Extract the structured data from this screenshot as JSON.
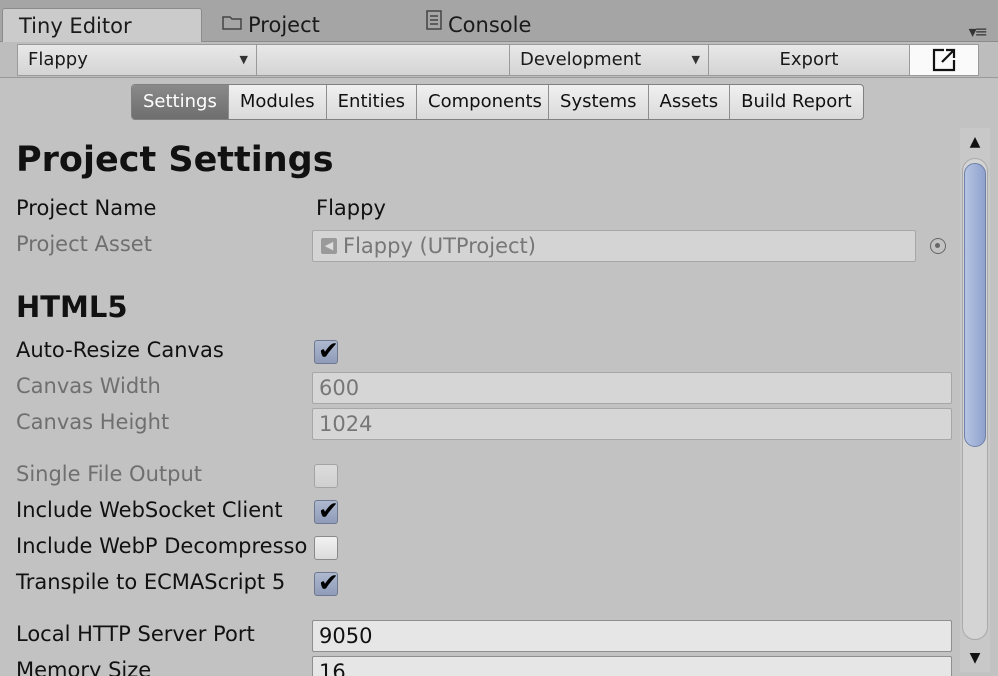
{
  "window_tabs": [
    {
      "label": "Tiny Editor",
      "icon": "",
      "active": true
    },
    {
      "label": "Project",
      "icon": "folder-icon",
      "active": false
    },
    {
      "label": "Console",
      "icon": "document-icon",
      "active": false
    }
  ],
  "toolbar": {
    "project_select": "Flappy",
    "config_select": "Development",
    "export_label": "Export",
    "popout_icon": "external-link-icon"
  },
  "subtabs": [
    {
      "label": "Settings",
      "active": true
    },
    {
      "label": "Modules",
      "active": false
    },
    {
      "label": "Entities",
      "active": false
    },
    {
      "label": "Components",
      "active": false
    },
    {
      "label": "Systems",
      "active": false
    },
    {
      "label": "Assets",
      "active": false
    },
    {
      "label": "Build Report",
      "active": false
    }
  ],
  "project": {
    "heading": "Project Settings",
    "name_label": "Project Name",
    "name_value": "Flappy",
    "asset_label": "Project Asset",
    "asset_value": "Flappy (UTProject)"
  },
  "html5": {
    "heading": "HTML5",
    "auto_resize_label": "Auto-Resize Canvas",
    "auto_resize_checked": true,
    "width_label": "Canvas Width",
    "width_value": "600",
    "height_label": "Canvas Height",
    "height_value": "1024",
    "single_file_label": "Single File Output",
    "single_file_checked": false,
    "websocket_label": "Include WebSocket Client",
    "websocket_checked": true,
    "webp_label": "Include WebP Decompresso",
    "webp_checked": false,
    "transpile_label": "Transpile to ECMAScript 5",
    "transpile_checked": true,
    "port_label": "Local HTTP Server Port",
    "port_value": "9050",
    "memory_label": "Memory Size",
    "memory_value": "16"
  },
  "colors": {
    "accent": "#8fa2cc",
    "active_tab": "#7a7a7a",
    "background": "#c2c2c2"
  }
}
